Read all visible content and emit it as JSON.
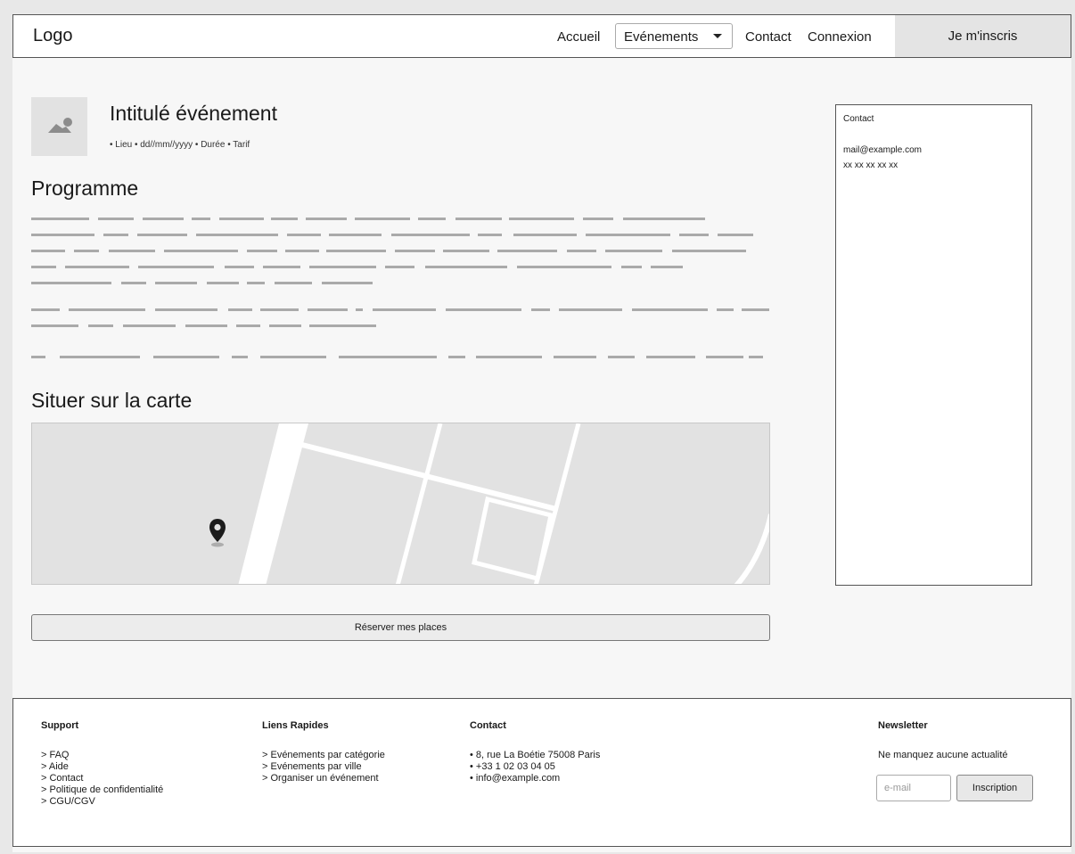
{
  "header": {
    "logo": "Logo",
    "nav": {
      "home": "Accueil",
      "events": "Evénements",
      "contact": "Contact",
      "login": "Connexion"
    },
    "signup_label": "Je m'inscris"
  },
  "event": {
    "title": "Intitulé événement",
    "meta": "• Lieu • dd//mm//yyyy • Durée • Tarif",
    "thumbnail_icon": "image-placeholder-icon"
  },
  "program": {
    "title": "Programme"
  },
  "map_section": {
    "title": "Situer sur la carte",
    "marker_icon": "map-pin-icon"
  },
  "booking": {
    "button_label": "Réserver mes places"
  },
  "sidebar": {
    "title": "Contact",
    "email": "mail@example.com",
    "phone": "xx xx xx xx xx"
  },
  "footer": {
    "support": {
      "title": "Support",
      "items": [
        "> FAQ",
        "> Aide",
        "> Contact",
        "> Politique de confidentialité",
        "> CGU/CGV"
      ]
    },
    "quick_links": {
      "title": "Liens Rapides",
      "items": [
        "> Evénements par catégorie",
        "> Evénements par ville",
        "> Organiser un événement"
      ]
    },
    "contact": {
      "title": "Contact",
      "items": [
        "• 8, rue La Boétie 75008 Paris",
        "• +33 1 02 03 04 05",
        "• info@example.com"
      ]
    },
    "newsletter": {
      "title": "Newsletter",
      "subtitle": "Ne manquez aucune actualité",
      "email_placeholder": "e-mail",
      "button_label": "Inscription"
    }
  },
  "colors": {
    "background": "#e8e8e8",
    "placeholder_bar": "#aaaaaa",
    "map_background": "#e2e2e2",
    "button_background": "#ececec"
  }
}
